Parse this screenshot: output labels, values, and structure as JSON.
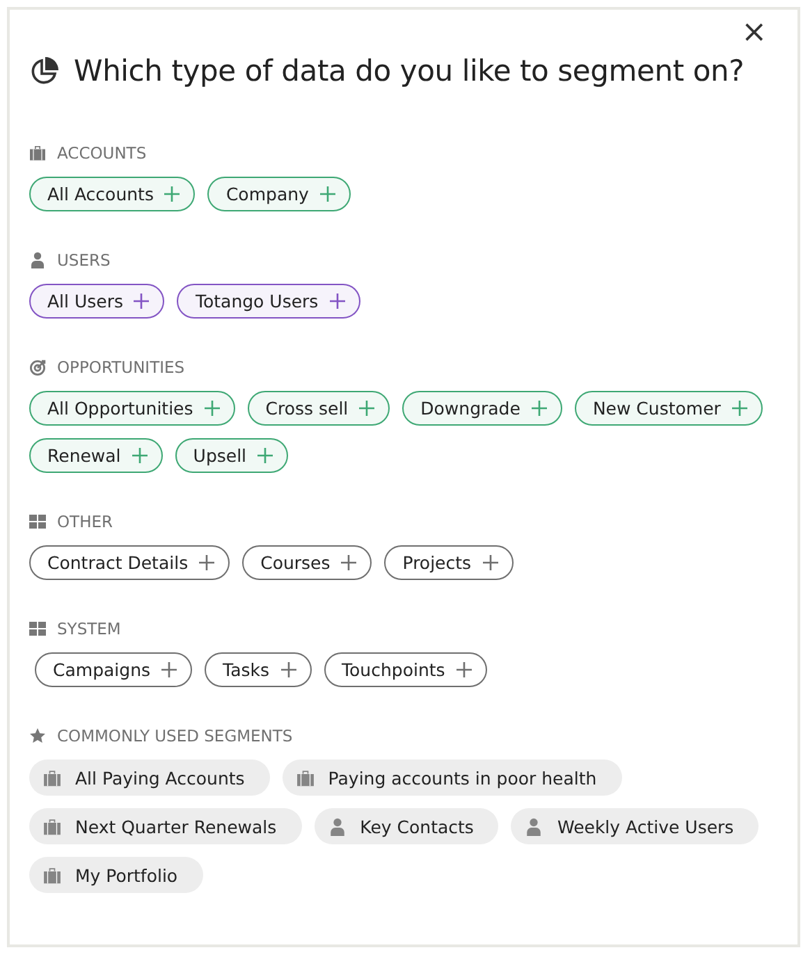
{
  "dialog": {
    "title": "Which type of data do you like to segment on?",
    "close": "×"
  },
  "sections": [
    {
      "label": "ACCOUNTS",
      "kind": "briefcase",
      "color": "#3ea874",
      "items": [
        "All Accounts",
        "Company"
      ]
    },
    {
      "label": "USERS",
      "kind": "person",
      "color": "#8354c4",
      "items": [
        "All Users",
        "Totango Users"
      ]
    },
    {
      "label": "OPPORTUNITIES",
      "kind": "target",
      "color": "#3ea874",
      "items": [
        "All Opportunities",
        "Cross sell",
        "Downgrade",
        "New Customer",
        "Renewal",
        "Upsell"
      ]
    },
    {
      "label": "OTHER",
      "kind": "grid",
      "color": "#6f6f6f",
      "items": [
        "Contract Details",
        "Courses",
        "Projects"
      ]
    },
    {
      "label": "SYSTEM",
      "kind": "grid",
      "color": "#6f6f6f",
      "items": [
        "Campaigns",
        "Tasks",
        "Touchpoints"
      ]
    }
  ],
  "common": {
    "label": "COMMONLY USED SEGMENTS",
    "items": [
      {
        "label": "All Paying Accounts",
        "kind": "briefcase"
      },
      {
        "label": "Paying accounts in poor health",
        "kind": "briefcase"
      },
      {
        "label": "Next Quarter Renewals",
        "kind": "briefcase"
      },
      {
        "label": "Key Contacts",
        "kind": "person"
      },
      {
        "label": "Weekly Active Users",
        "kind": "person"
      },
      {
        "label": "My Portfolio",
        "kind": "briefcase"
      }
    ]
  }
}
